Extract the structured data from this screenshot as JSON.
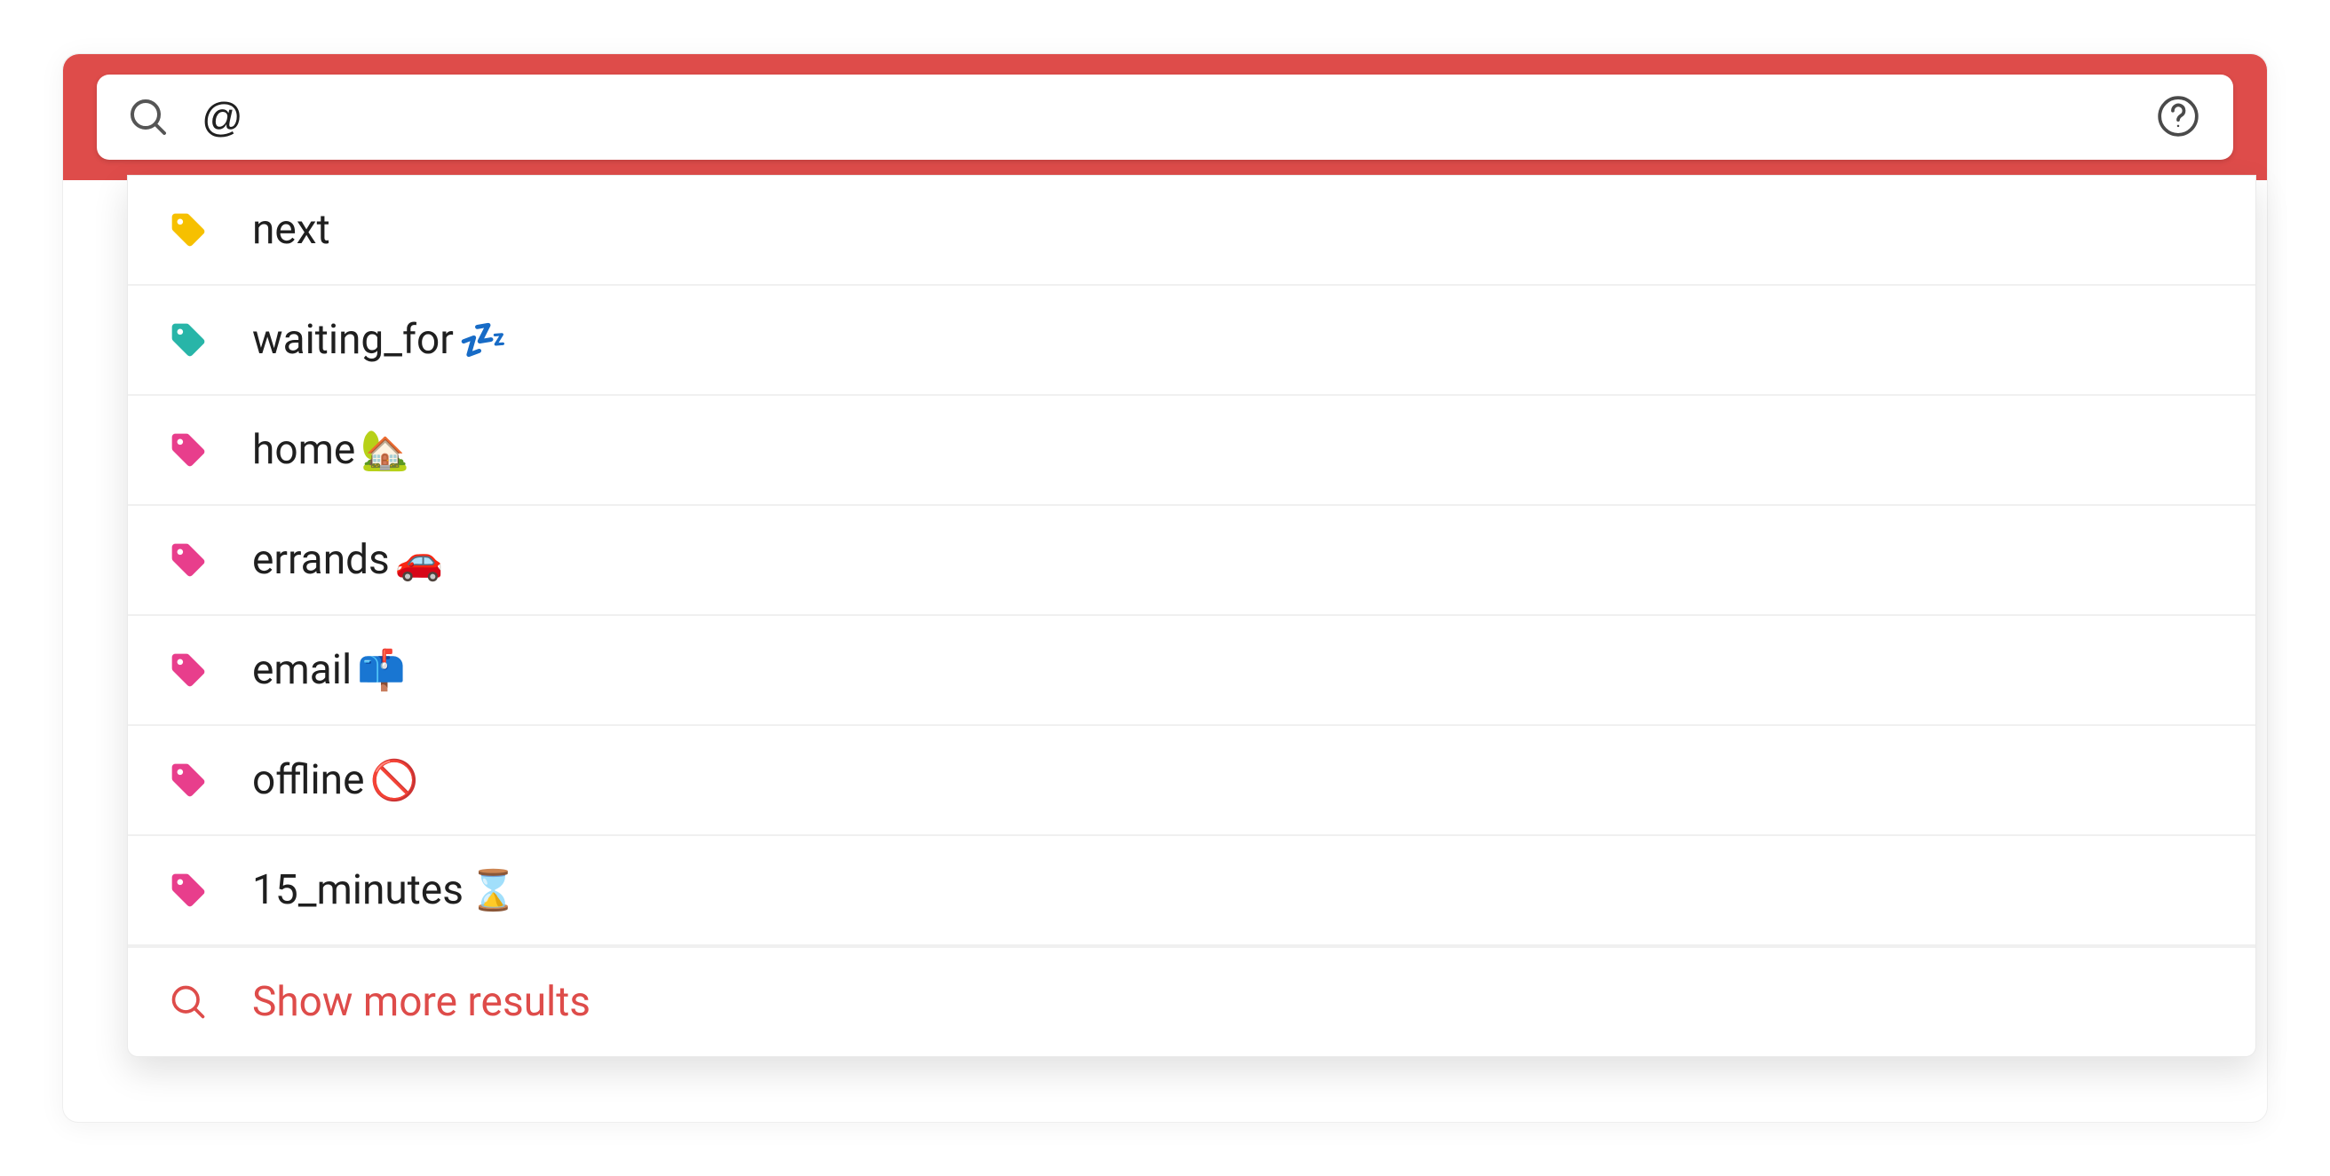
{
  "search": {
    "value": "@",
    "placeholder": ""
  },
  "colors": {
    "titlebar": "#de4c4a",
    "accent": "#de4c4a",
    "tag_yellow": "#f6c000",
    "tag_teal": "#28b5a8",
    "tag_pink": "#e83e8c",
    "icon_gray": "#555555",
    "help_gray": "#4a4a4a"
  },
  "icons": {
    "search": "search-icon",
    "help": "help-icon",
    "tag": "tag-icon",
    "sm_search": "search-icon"
  },
  "items": [
    {
      "label": "next",
      "emoji": "",
      "color": "tag_yellow"
    },
    {
      "label": "waiting_for",
      "emoji": "💤",
      "color": "tag_teal"
    },
    {
      "label": "home",
      "emoji": "🏡",
      "color": "tag_pink"
    },
    {
      "label": "errands",
      "emoji": "🚗",
      "color": "tag_pink"
    },
    {
      "label": "email",
      "emoji": "📫",
      "color": "tag_pink"
    },
    {
      "label": "offline",
      "emoji": "🚫",
      "color": "tag_pink"
    },
    {
      "label": "15_minutes",
      "emoji": "⌛",
      "color": "tag_pink"
    }
  ],
  "showMore": {
    "label": "Show more results"
  }
}
